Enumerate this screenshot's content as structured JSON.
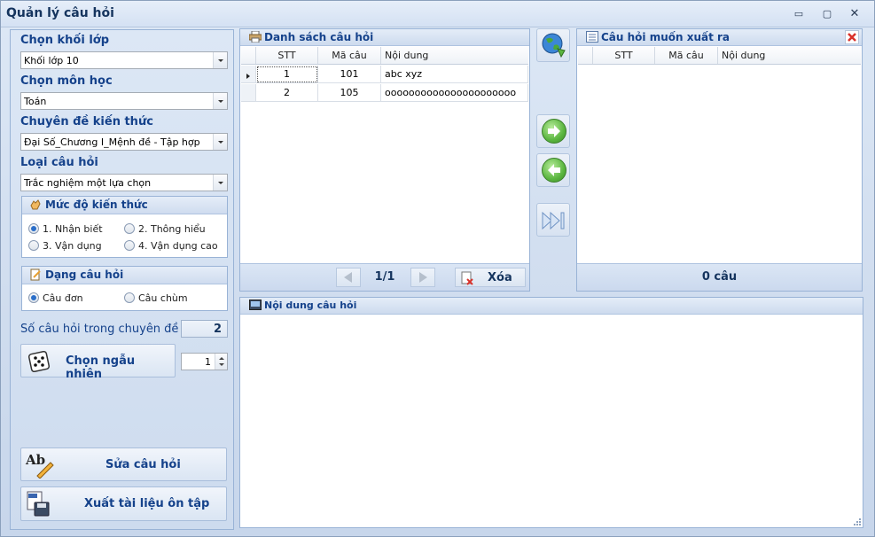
{
  "window": {
    "title": "Quản lý câu hỏi",
    "controls": [
      "▭",
      "▢",
      "✕"
    ]
  },
  "filters": {
    "grade_label": "Chọn khối lớp",
    "grade_value": "Khối lớp 10",
    "subject_label": "Chọn môn học",
    "subject_value": "Toán",
    "topic_label": "Chuyên đề kiến thức",
    "topic_value": "Đại Số_Chương I_Mệnh đề - Tập hợp",
    "type_label": "Loại câu hỏi",
    "type_value": "Trắc nghiệm một lựa chọn"
  },
  "level_group": {
    "title": "Mức độ kiến thức",
    "options": [
      "1. Nhận biết",
      "2. Thông hiểu",
      "3. Vận dụng",
      "4. Vận dụng cao"
    ],
    "selected_index": 0
  },
  "form_group": {
    "title": "Dạng câu hỏi",
    "options": [
      "Câu đơn",
      "Câu chùm"
    ],
    "selected_index": 0
  },
  "count": {
    "label": "Số câu hỏi trong chuyên đề :",
    "value": "2"
  },
  "random": {
    "label": "Chọn ngẫu nhiên",
    "quantity": "1"
  },
  "actions": {
    "edit_label": "Sửa câu hỏi",
    "export_label": "Xuất tài liệu ôn tập",
    "edit_icon_text": "Ab"
  },
  "question_list": {
    "title": "Danh sách câu hỏi",
    "columns": [
      "STT",
      "Mã câu",
      "Nội dung"
    ],
    "rows": [
      {
        "stt": "1",
        "code": "101",
        "content": "abc xyz"
      },
      {
        "stt": "2",
        "code": "105",
        "content": "oooooooooooooooooooooo"
      }
    ],
    "page": "1/1",
    "delete_label": "Xóa"
  },
  "export_list": {
    "title": "Câu hỏi muốn xuất ra",
    "columns": [
      "STT",
      "Mã câu",
      "Nội dung"
    ],
    "summary": "0 câu"
  },
  "content_panel": {
    "title": "Nội dung câu hỏi"
  },
  "colors": {
    "header_text": "#15428b",
    "accent_green": "#5bb640",
    "close_red": "#d9322b"
  }
}
